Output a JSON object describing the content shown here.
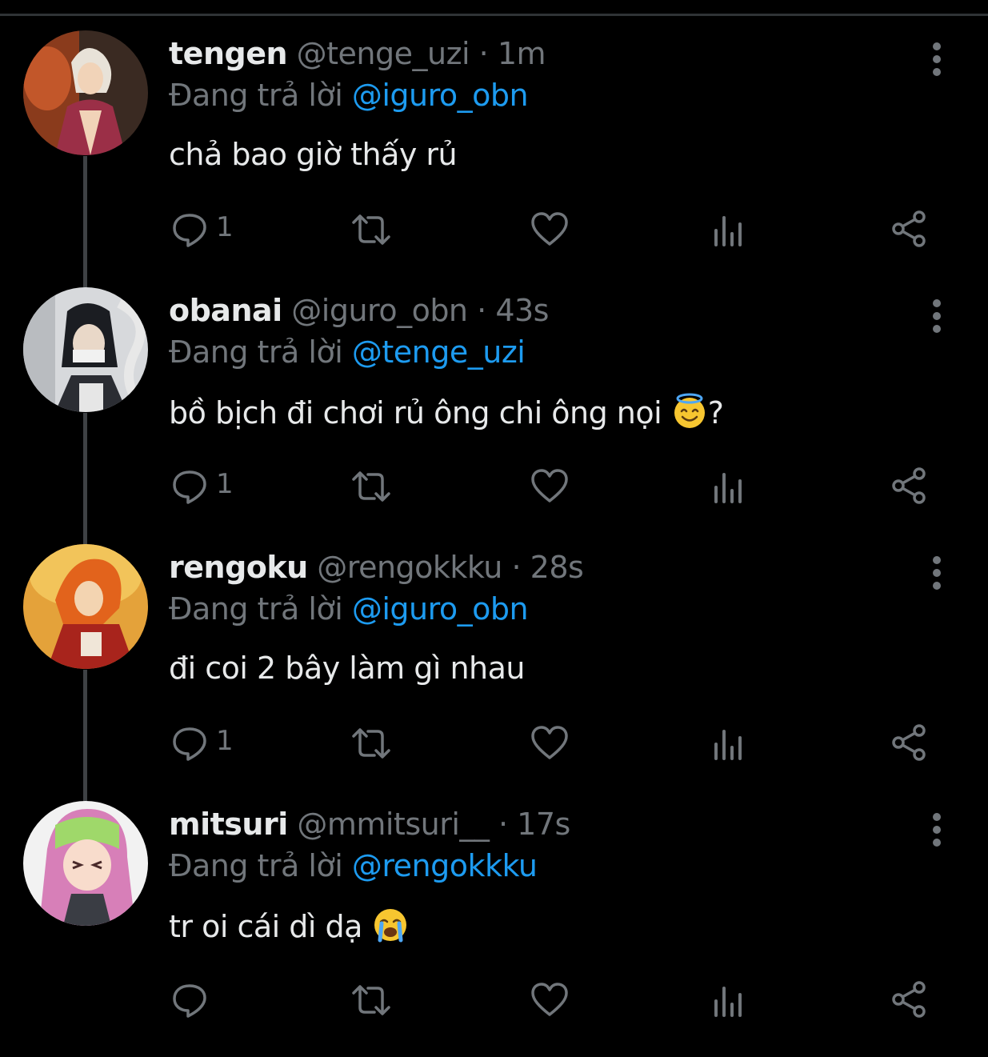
{
  "colors": {
    "background": "#000000",
    "text": "#e7e9ea",
    "muted": "#71767b",
    "link": "#1d9bf0",
    "thread_line": "#3e4144"
  },
  "tweets": [
    {
      "name": "tengen",
      "handle": "@tenge_uzi",
      "dot": "·",
      "time": "1m",
      "reply_prefix": "Đang trả lời",
      "reply_to": "@iguro_obn",
      "text": "chả bao giờ thấy rủ",
      "emoji": "",
      "text_suffix": "",
      "reply_count": "1",
      "avatar_icon": "tengen-avatar"
    },
    {
      "name": "obanai",
      "handle": "@iguro_obn",
      "dot": "·",
      "time": "43s",
      "reply_prefix": "Đang trả lời",
      "reply_to": "@tenge_uzi",
      "text": "bồ bịch đi chơi rủ ông chi ông nọi",
      "emoji": "smiling-face-with-halo",
      "text_suffix": "?",
      "reply_count": "1",
      "avatar_icon": "obanai-avatar"
    },
    {
      "name": "rengoku",
      "handle": "@rengokkku",
      "dot": "·",
      "time": "28s",
      "reply_prefix": "Đang trả lời",
      "reply_to": "@iguro_obn",
      "text": "đi coi 2 bây làm gì nhau",
      "emoji": "",
      "text_suffix": "",
      "reply_count": "1",
      "avatar_icon": "rengoku-avatar"
    },
    {
      "name": "mitsuri",
      "handle": "@mmitsuri__",
      "dot": "·",
      "time": "17s",
      "reply_prefix": "Đang trả lời",
      "reply_to": "@rengokkku",
      "text": "tr oi cái dì dạ",
      "emoji": "loudly-crying-face",
      "text_suffix": "",
      "reply_count": "",
      "avatar_icon": "mitsuri-avatar"
    }
  ],
  "icons": {
    "reply": "reply-icon",
    "retweet": "retweet-icon",
    "like": "heart-icon",
    "views": "views-icon",
    "share": "share-icon",
    "more": "more-vertical-icon"
  }
}
